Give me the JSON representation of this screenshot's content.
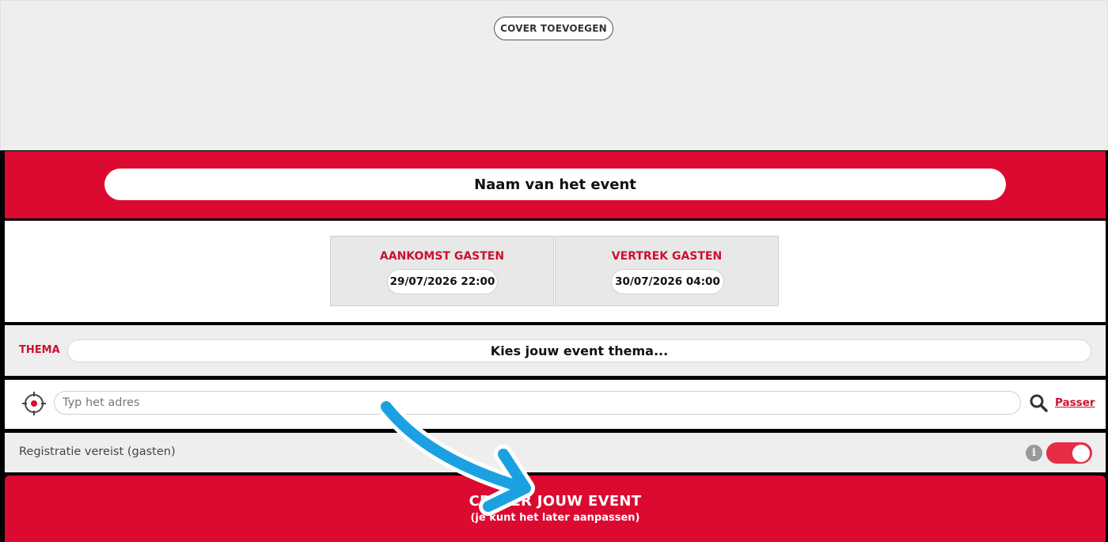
{
  "cover": {
    "add_cover_label": "COVER TOEVOEGEN"
  },
  "event": {
    "name_placeholder": "Naam van het event"
  },
  "dates": {
    "arrival_title": "AANKOMST GASTEN",
    "arrival_value": "29/07/2026 22:00",
    "departure_title": "VERTREK GASTEN",
    "departure_value": "30/07/2026 04:00"
  },
  "theme": {
    "label": "THEMA",
    "placeholder": "Kies jouw event thema..."
  },
  "address": {
    "placeholder": "Typ het adres",
    "skip_label": "Passer",
    "icons": [
      "target-icon",
      "search-icon"
    ]
  },
  "registration": {
    "label": "Registratie vereist (gasten)",
    "info_glyph": "i",
    "toggle_on": true
  },
  "create": {
    "title": "CREËER JOUW EVENT",
    "subtitle": "(je kunt het later aanpassen)"
  },
  "colors": {
    "brand_red": "#dc0a30",
    "panel_grey": "#efeeee",
    "annotation_arrow": "#1ba1e2"
  }
}
